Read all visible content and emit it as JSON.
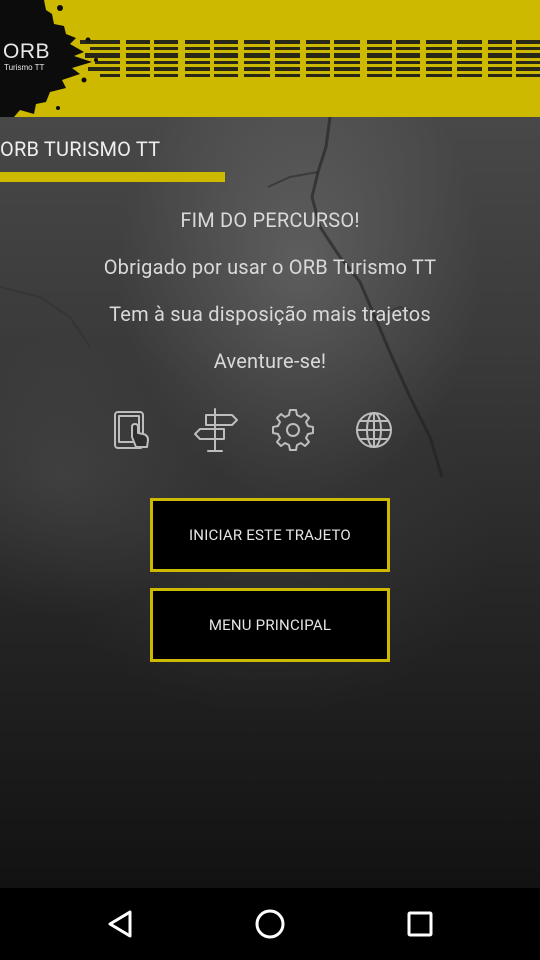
{
  "header": {
    "logo_main": "ORB",
    "logo_sub": "Turismo TT",
    "accent_color": "#cdb900"
  },
  "main": {
    "section_title": "ORB TURISMO TT",
    "messages": [
      "FIM DO PERCURSO!",
      "Obrigado por usar o ORB Turismo TT",
      "Tem à sua disposição mais trajetos",
      "Aventure-se!"
    ],
    "icons": [
      "tablet-touch-icon",
      "signpost-icon",
      "gear-icon",
      "globe-icon"
    ],
    "buttons": {
      "start_route": "INICIAR ESTE TRAJETO",
      "main_menu": "MENU PRINCIPAL"
    }
  },
  "navbar": {
    "items": [
      "back-icon",
      "home-icon",
      "recents-icon"
    ]
  }
}
